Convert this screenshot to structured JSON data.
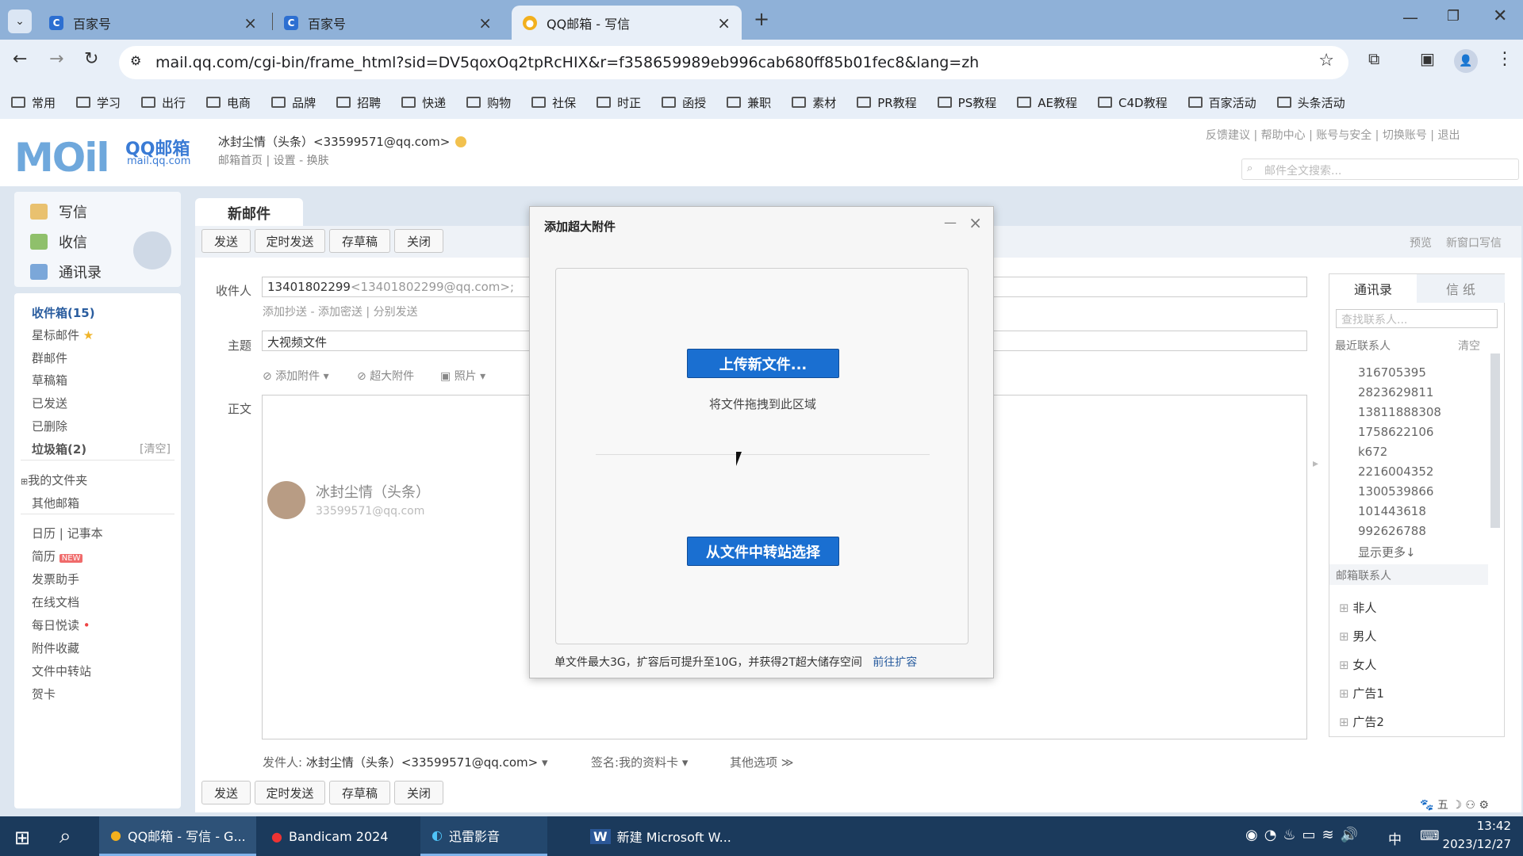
{
  "browser": {
    "tabs": [
      {
        "label": "百家号",
        "icon": "baijiahao-icon"
      },
      {
        "label": "百家号",
        "icon": "baijiahao-icon"
      },
      {
        "label": "QQ邮箱 - 写信",
        "icon": "chrome-icon"
      }
    ],
    "url": "mail.qq.com/cgi-bin/frame_html?sid=DV5qoxOq2tpRcHIX&r=f358659989eb996cab680ff85b01fec8&lang=zh",
    "bookmarks": [
      "常用",
      "学习",
      "出行",
      "电商",
      "品牌",
      "招聘",
      "快递",
      "购物",
      "社保",
      "时正",
      "函授",
      "兼职",
      "素材",
      "PR教程",
      "PS教程",
      "AE教程",
      "C4D教程",
      "百家活动",
      "头条活动"
    ]
  },
  "mail": {
    "logo_text": "MOil",
    "brand": "QQ邮箱",
    "brand_url": "mail.qq.com",
    "user": "冰封尘情（头条）<33599571@qq.com>",
    "user_links": "邮箱首页 | 设置 - 换肤",
    "top_links": "反馈建议 | 帮助中心 | 账号与安全 | 切换账号 | 退出",
    "search_placeholder": "邮件全文搜索..."
  },
  "quick": {
    "write": "写信",
    "inbox": "收信",
    "contacts": "通讯录"
  },
  "folders": {
    "inbox": "收件箱(15)",
    "star": "星标邮件",
    "group": "群邮件",
    "drafts": "草稿箱",
    "sent": "已发送",
    "deleted": "已删除",
    "spam": "垃圾箱(2)",
    "spam_clear": "[清空]",
    "my_folders": "我的文件夹",
    "other": "其他邮箱",
    "calendar": "日历",
    "notes": "记事本",
    "resume": "简历",
    "new_badge": "NEW",
    "invoice": "发票助手",
    "online_doc": "在线文档",
    "daily": "每日悦读",
    "attach_fav": "附件收藏",
    "transfer": "文件中转站",
    "card": "贺卡"
  },
  "compose": {
    "tab": "新邮件",
    "send": "发送",
    "timed": "定时发送",
    "draft": "存草稿",
    "close": "关闭",
    "preview": "预览",
    "new_window": "新窗口写信",
    "to_label": "收件人",
    "to_value": "13401802299",
    "to_hint": "<13401802299@qq.com>;",
    "cc_links": "添加抄送 - 添加密送 | 分别发送",
    "subject_label": "主题",
    "subject": "大视频文件",
    "attach": "添加附件",
    "big_attach": "超大附件",
    "photo": "照片",
    "body_label": "正文",
    "sig_name": "冰封尘情（头条）",
    "sig_email": "33599571@qq.com",
    "sender_label": "发件人:",
    "sender": "冰封尘情（头条）<33599571@qq.com>",
    "sign_label": "签名:",
    "sign_value": "我的资料卡",
    "other_opts": "其他选项"
  },
  "contacts": {
    "tab1": "通讯录",
    "tab2": "信 纸",
    "search": "查找联系人...",
    "recent": "最近联系人",
    "clear": "清空",
    "numbers": [
      "316705395",
      "2823629811",
      "13811888308",
      "1758622106",
      "k672",
      "2216004352",
      "1300539866",
      "101443618",
      "992626788"
    ],
    "more": "显示更多↓",
    "book": "邮箱联系人",
    "groups": [
      "非人",
      "男人",
      "女人",
      "广告1",
      "广告2"
    ]
  },
  "modal": {
    "title": "添加超大附件",
    "upload": "上传新文件...",
    "drag": "将文件拖拽到此区域",
    "from_transfer": "从文件中转站选择",
    "footer": "单文件最大3G，扩容后可提升至10G，并获得2T超大储存空间",
    "expand": "前往扩容"
  },
  "taskbar": {
    "items": [
      "QQ邮箱 - 写信 - G...",
      "Bandicam 2024",
      "迅雷影音",
      "新建 Microsoft W..."
    ],
    "time": "13:42",
    "date": "2023/12/27",
    "ime": "中"
  },
  "colors": {
    "accent": "#1a6fd1",
    "tabbar": "#8fb1d8",
    "taskbar": "#1b3a5c"
  }
}
